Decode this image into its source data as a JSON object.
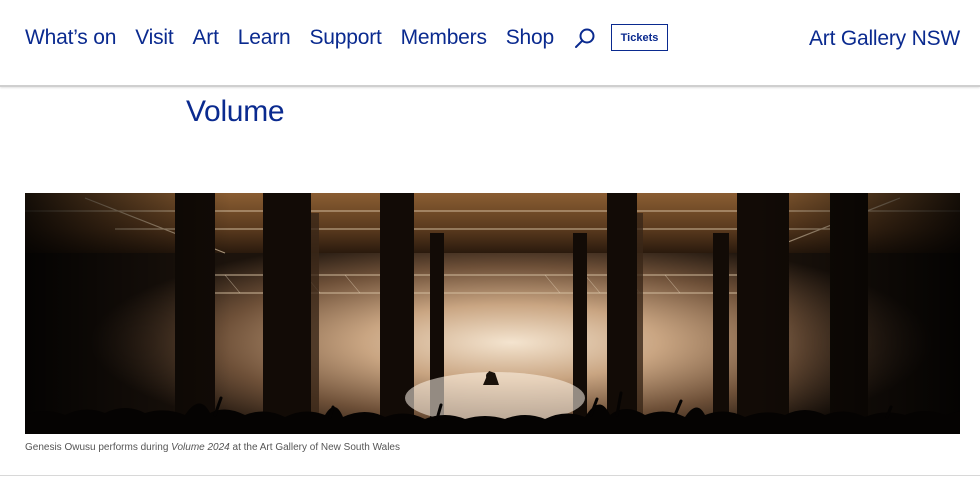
{
  "nav": {
    "items": [
      {
        "label": "What’s on"
      },
      {
        "label": "Visit"
      },
      {
        "label": "Art"
      },
      {
        "label": "Learn"
      },
      {
        "label": "Support"
      },
      {
        "label": "Members"
      },
      {
        "label": "Shop"
      }
    ],
    "search_icon": "search-icon",
    "tickets_label": "Tickets"
  },
  "brand": "Art Gallery NSW",
  "page": {
    "title": "Volume"
  },
  "hero": {
    "caption_prefix": "Genesis Owusu performs during ",
    "caption_italic": "Volume 2024",
    "caption_suffix": " at the Art Gallery of New South Wales"
  },
  "colors": {
    "brand_blue": "#0a2a8f",
    "caption_gray": "#555555"
  }
}
